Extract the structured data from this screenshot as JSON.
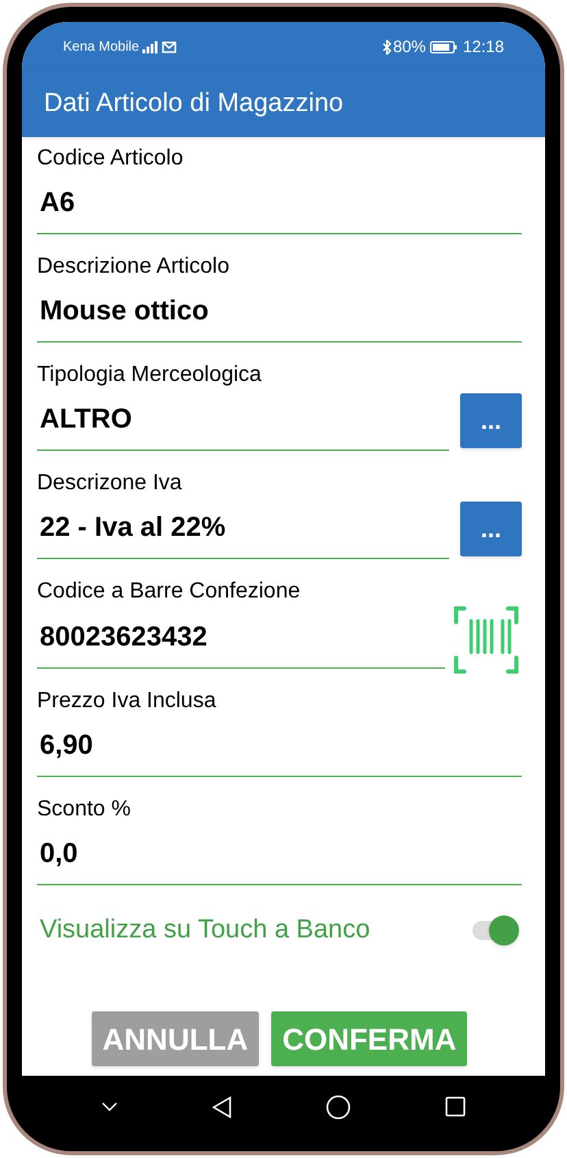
{
  "status_bar": {
    "carrier": "Kena Mobile",
    "battery": "80%",
    "time": "12:18"
  },
  "app_bar": {
    "title": "Dati Articolo di Magazzino"
  },
  "fields": [
    {
      "kind": "text",
      "label": "Codice Articolo",
      "value": "A6"
    },
    {
      "kind": "text",
      "label": "Descrizione Articolo",
      "value": "Mouse ottico"
    },
    {
      "kind": "lookup",
      "label": "Tipologia Merceologica",
      "value": "ALTRO",
      "button": "..."
    },
    {
      "kind": "lookup",
      "label": "Descrizone Iva",
      "value": "22 - Iva al 22%",
      "button": "..."
    },
    {
      "kind": "barcode",
      "label": "Codice a Barre Confezione",
      "value": "80023623432"
    },
    {
      "kind": "text",
      "label": "Prezzo Iva Inclusa",
      "value": "6,90"
    },
    {
      "kind": "text",
      "label": "Sconto %",
      "value": "0,0"
    }
  ],
  "toggle": {
    "label": "Visualizza su Touch a Banco",
    "on": true
  },
  "buttons": [
    {
      "kind": "cancel",
      "label": "ANNULLA"
    },
    {
      "kind": "confirm",
      "label": "CONFERMA"
    }
  ]
}
